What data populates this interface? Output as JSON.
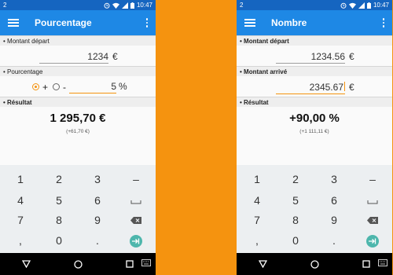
{
  "status_bar": {
    "left": "2",
    "time": "10:47"
  },
  "left_screen": {
    "app_title": "Pourcentage",
    "start_section": "Montant départ",
    "start_value": "1234",
    "start_unit": "€",
    "percent_section": "Pourcentage",
    "plus_sign": "+",
    "minus_sign": "-",
    "percent_value": "5",
    "percent_unit": "%",
    "result_section": "Résultat",
    "result_value": "1 295,70 €",
    "result_detail": "(+61,70 €)"
  },
  "right_screen": {
    "app_title": "Nombre",
    "start_section": "Montant départ",
    "start_value": "1234.56",
    "start_unit": "€",
    "end_section": "Montant arrivé",
    "end_value": "2345.67",
    "end_unit": "€",
    "result_section": "Résultat",
    "result_value": "+90,00 %",
    "result_detail": "(+1 111,11 €)"
  },
  "keypad": {
    "k1": "1",
    "k2": "2",
    "k3": "3",
    "minus": "–",
    "k4": "4",
    "k5": "5",
    "k6": "6",
    "k7": "7",
    "k8": "8",
    "k9": "9",
    "comma": ",",
    "k0": "0",
    "dot": "."
  },
  "colors": {
    "accent": "#f5930f",
    "appbar": "#1e88e5",
    "statusbar": "#1565c0",
    "enter_key": "#4db6ac"
  }
}
